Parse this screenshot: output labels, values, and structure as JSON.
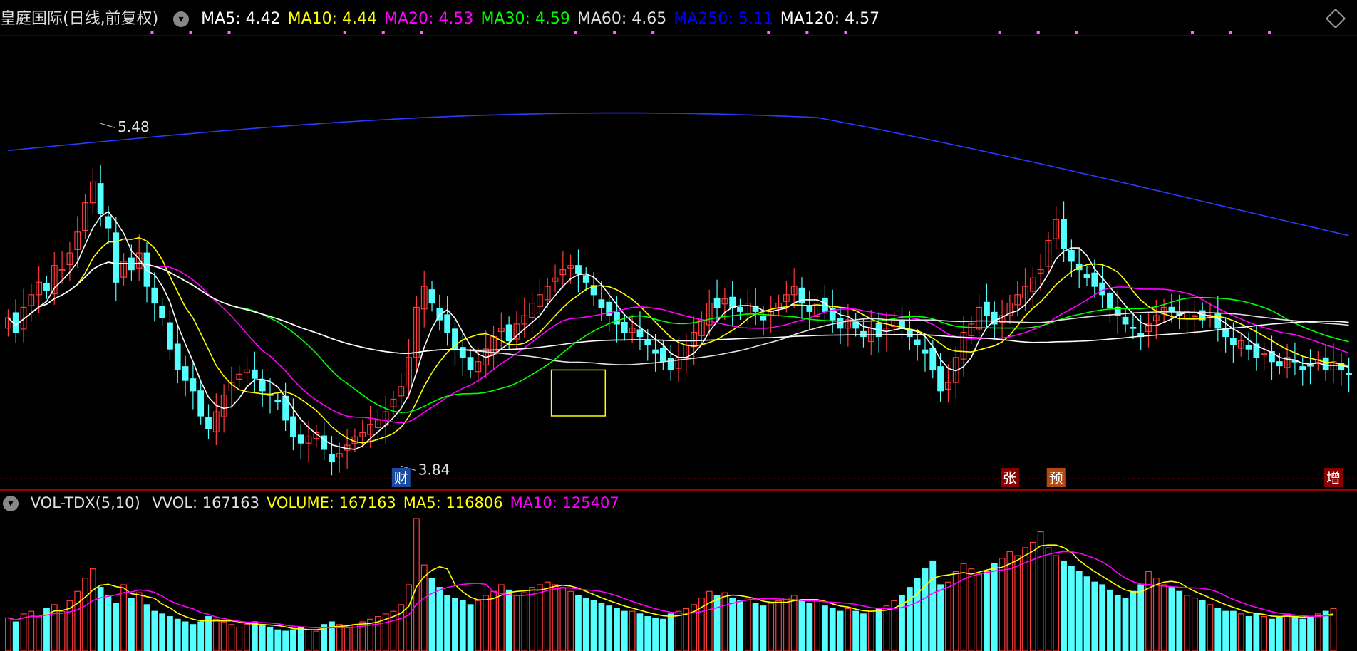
{
  "header": {
    "stock_title": "皇庭国际(日线,前复权)",
    "ma_items": [
      {
        "label": "MA5: 4.42",
        "color": "#ffffff"
      },
      {
        "label": "MA10: 4.44",
        "color": "#ffff00"
      },
      {
        "label": "MA20: 4.53",
        "color": "#ff00ff"
      },
      {
        "label": "MA30: 4.59",
        "color": "#00ff00"
      },
      {
        "label": "MA60: 4.65",
        "color": "#e0e0e0"
      },
      {
        "label": "MA250: 5.11",
        "color": "#0000ff"
      },
      {
        "label": "MA120: 4.57",
        "color": "#ffffff"
      }
    ]
  },
  "volume_header": {
    "indicator": "VOL-TDX(5,10)",
    "items": [
      {
        "label": "VVOL: 167163",
        "color": "#e0e0e0"
      },
      {
        "label": "VOLUME: 167163",
        "color": "#ffff00"
      },
      {
        "label": "MA5: 116806",
        "color": "#ffff00"
      },
      {
        "label": "MA10: 125407",
        "color": "#ff00ff"
      }
    ]
  },
  "markers": [
    {
      "text": "财",
      "bar": 51
    },
    {
      "text": "张",
      "bar": 130
    },
    {
      "text": "预",
      "bar": 136
    },
    {
      "text": "增",
      "bar": 172
    }
  ],
  "colors": {
    "up": "#ff3b3b",
    "down": "#54ffff",
    "bg": "#000000",
    "grid": "#7a0000"
  },
  "chart_data": {
    "type": "candlestick",
    "price_annotations": [
      {
        "label": "5.48",
        "value": 5.48
      },
      {
        "label": "3.84",
        "value": 3.84
      }
    ],
    "price_range": [
      3.78,
      5.9
    ],
    "closes": [
      4.55,
      4.48,
      4.6,
      4.66,
      4.72,
      4.68,
      4.8,
      4.78,
      4.86,
      4.96,
      5.1,
      5.2,
      5.05,
      4.98,
      4.72,
      4.82,
      4.78,
      4.86,
      4.7,
      4.62,
      4.55,
      4.4,
      4.3,
      4.25,
      4.2,
      4.08,
      4.02,
      4.1,
      4.18,
      4.24,
      4.28,
      4.3,
      4.26,
      4.2,
      4.18,
      4.15,
      4.06,
      3.98,
      3.95,
      3.98,
      4.0,
      3.92,
      3.86,
      3.9,
      3.94,
      3.98,
      4.0,
      4.04,
      4.06,
      4.1,
      4.16,
      4.22,
      4.36,
      4.6,
      4.7,
      4.62,
      4.54,
      4.48,
      4.4,
      4.36,
      4.3,
      4.34,
      4.4,
      4.46,
      4.5,
      4.44,
      4.52,
      4.56,
      4.62,
      4.66,
      4.7,
      4.74,
      4.78,
      4.8,
      4.76,
      4.72,
      4.66,
      4.6,
      4.56,
      4.52,
      4.48,
      4.5,
      4.46,
      4.42,
      4.38,
      4.34,
      4.3,
      4.36,
      4.42,
      4.48,
      4.54,
      4.62,
      4.6,
      4.64,
      4.6,
      4.58,
      4.62,
      4.58,
      4.54,
      4.58,
      4.62,
      4.66,
      4.7,
      4.62,
      4.58,
      4.62,
      4.58,
      4.54,
      4.5,
      4.54,
      4.5,
      4.46,
      4.5,
      4.46,
      4.5,
      4.54,
      4.5,
      4.46,
      4.42,
      4.38,
      4.3,
      4.2,
      4.24,
      4.36,
      4.48,
      4.52,
      4.6,
      4.56,
      4.52,
      4.56,
      4.62,
      4.66,
      4.7,
      4.74,
      4.78,
      4.92,
      5.02,
      4.88,
      4.82,
      4.78,
      4.74,
      4.7,
      4.66,
      4.6,
      4.56,
      4.52,
      4.5,
      4.46,
      4.52,
      4.56,
      4.6,
      4.58,
      4.56,
      4.58,
      4.56,
      4.54,
      4.56,
      4.5,
      4.46,
      4.42,
      4.44,
      4.4,
      4.36,
      4.38,
      4.34,
      4.32,
      4.36,
      4.34,
      4.3,
      4.32,
      4.35,
      4.3,
      4.34,
      4.3,
      4.28
    ],
    "volumes": [
      0.25,
      0.22,
      0.28,
      0.3,
      0.26,
      0.32,
      0.35,
      0.3,
      0.38,
      0.45,
      0.55,
      0.62,
      0.48,
      0.42,
      0.36,
      0.5,
      0.4,
      0.44,
      0.35,
      0.3,
      0.28,
      0.26,
      0.24,
      0.22,
      0.2,
      0.22,
      0.26,
      0.24,
      0.22,
      0.2,
      0.18,
      0.2,
      0.22,
      0.2,
      0.18,
      0.16,
      0.15,
      0.16,
      0.18,
      0.16,
      0.15,
      0.2,
      0.22,
      0.2,
      0.18,
      0.2,
      0.22,
      0.24,
      0.26,
      0.28,
      0.3,
      0.35,
      0.5,
      1.0,
      0.65,
      0.55,
      0.48,
      0.42,
      0.4,
      0.38,
      0.35,
      0.38,
      0.42,
      0.45,
      0.5,
      0.46,
      0.42,
      0.44,
      0.48,
      0.5,
      0.52,
      0.5,
      0.48,
      0.45,
      0.42,
      0.4,
      0.38,
      0.36,
      0.34,
      0.32,
      0.3,
      0.3,
      0.28,
      0.26,
      0.25,
      0.24,
      0.28,
      0.3,
      0.32,
      0.35,
      0.4,
      0.45,
      0.42,
      0.44,
      0.4,
      0.38,
      0.4,
      0.36,
      0.34,
      0.36,
      0.38,
      0.4,
      0.42,
      0.38,
      0.36,
      0.38,
      0.34,
      0.32,
      0.3,
      0.32,
      0.3,
      0.28,
      0.3,
      0.32,
      0.34,
      0.38,
      0.42,
      0.48,
      0.55,
      0.62,
      0.68,
      0.5,
      0.52,
      0.6,
      0.66,
      0.62,
      0.58,
      0.6,
      0.66,
      0.7,
      0.75,
      0.72,
      0.78,
      0.82,
      0.9,
      0.78,
      0.72,
      0.68,
      0.64,
      0.6,
      0.56,
      0.52,
      0.5,
      0.46,
      0.42,
      0.4,
      0.45,
      0.5,
      0.6,
      0.55,
      0.5,
      0.48,
      0.45,
      0.42,
      0.4,
      0.38,
      0.35,
      0.32,
      0.3,
      0.3,
      0.28,
      0.26,
      0.28,
      0.26,
      0.24,
      0.26,
      0.28,
      0.26,
      0.24,
      0.26,
      0.28,
      0.3,
      0.32
    ]
  }
}
